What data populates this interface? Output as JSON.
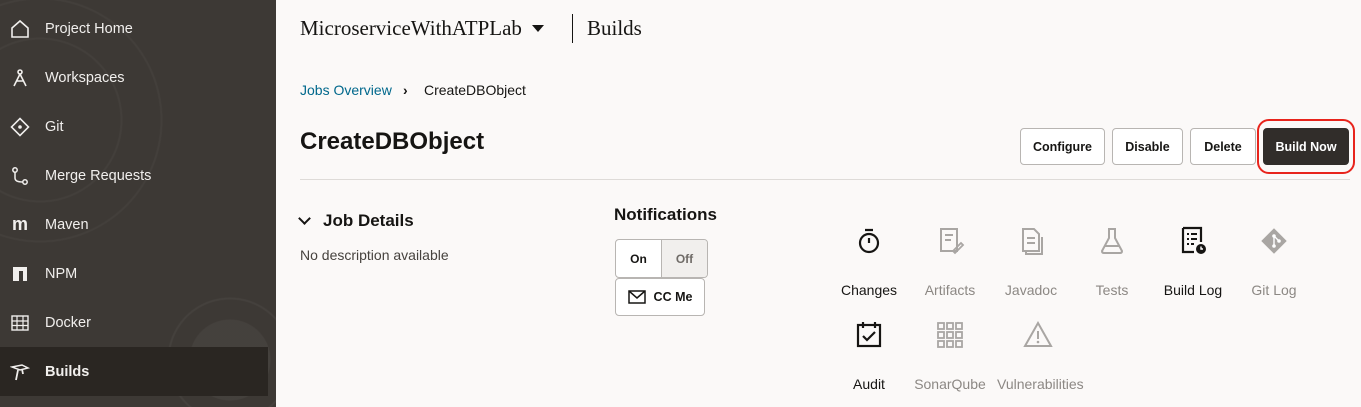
{
  "sidebar": {
    "items": [
      {
        "label": "Project Home",
        "icon": "home-icon"
      },
      {
        "label": "Workspaces",
        "icon": "workspace-icon"
      },
      {
        "label": "Git",
        "icon": "git-icon"
      },
      {
        "label": "Merge Requests",
        "icon": "merge-request-icon"
      },
      {
        "label": "Maven",
        "icon": "maven-icon"
      },
      {
        "label": "NPM",
        "icon": "npm-icon"
      },
      {
        "label": "Docker",
        "icon": "docker-icon"
      },
      {
        "label": "Builds",
        "icon": "builds-icon",
        "active": true
      }
    ]
  },
  "header": {
    "project": "MicroserviceWithATPLab",
    "section": "Builds"
  },
  "breadcrumb": {
    "parent": "Jobs Overview",
    "current": "CreateDBObject"
  },
  "job": {
    "title": "CreateDBObject",
    "buttons": {
      "configure": "Configure",
      "disable": "Disable",
      "delete": "Delete",
      "build_now": "Build Now"
    }
  },
  "details": {
    "title": "Job Details",
    "description": "No description available"
  },
  "notifications": {
    "title": "Notifications",
    "on": "On",
    "off": "Off",
    "cc_me": "CC Me"
  },
  "actions": [
    {
      "label": "Changes",
      "enabled": true
    },
    {
      "label": "Artifacts",
      "enabled": false
    },
    {
      "label": "Javadoc",
      "enabled": false
    },
    {
      "label": "Tests",
      "enabled": false
    },
    {
      "label": "Build Log",
      "enabled": true
    },
    {
      "label": "Git Log",
      "enabled": false
    },
    {
      "label": "Audit",
      "enabled": true
    },
    {
      "label": "SonarQube",
      "enabled": false
    },
    {
      "label": "Vulnerabilities",
      "enabled": false
    }
  ],
  "colors": {
    "sidebar_bg": "#3d3935",
    "link": "#00688c",
    "primary_button": "#312d2a",
    "highlight_ring": "#e8241c"
  }
}
